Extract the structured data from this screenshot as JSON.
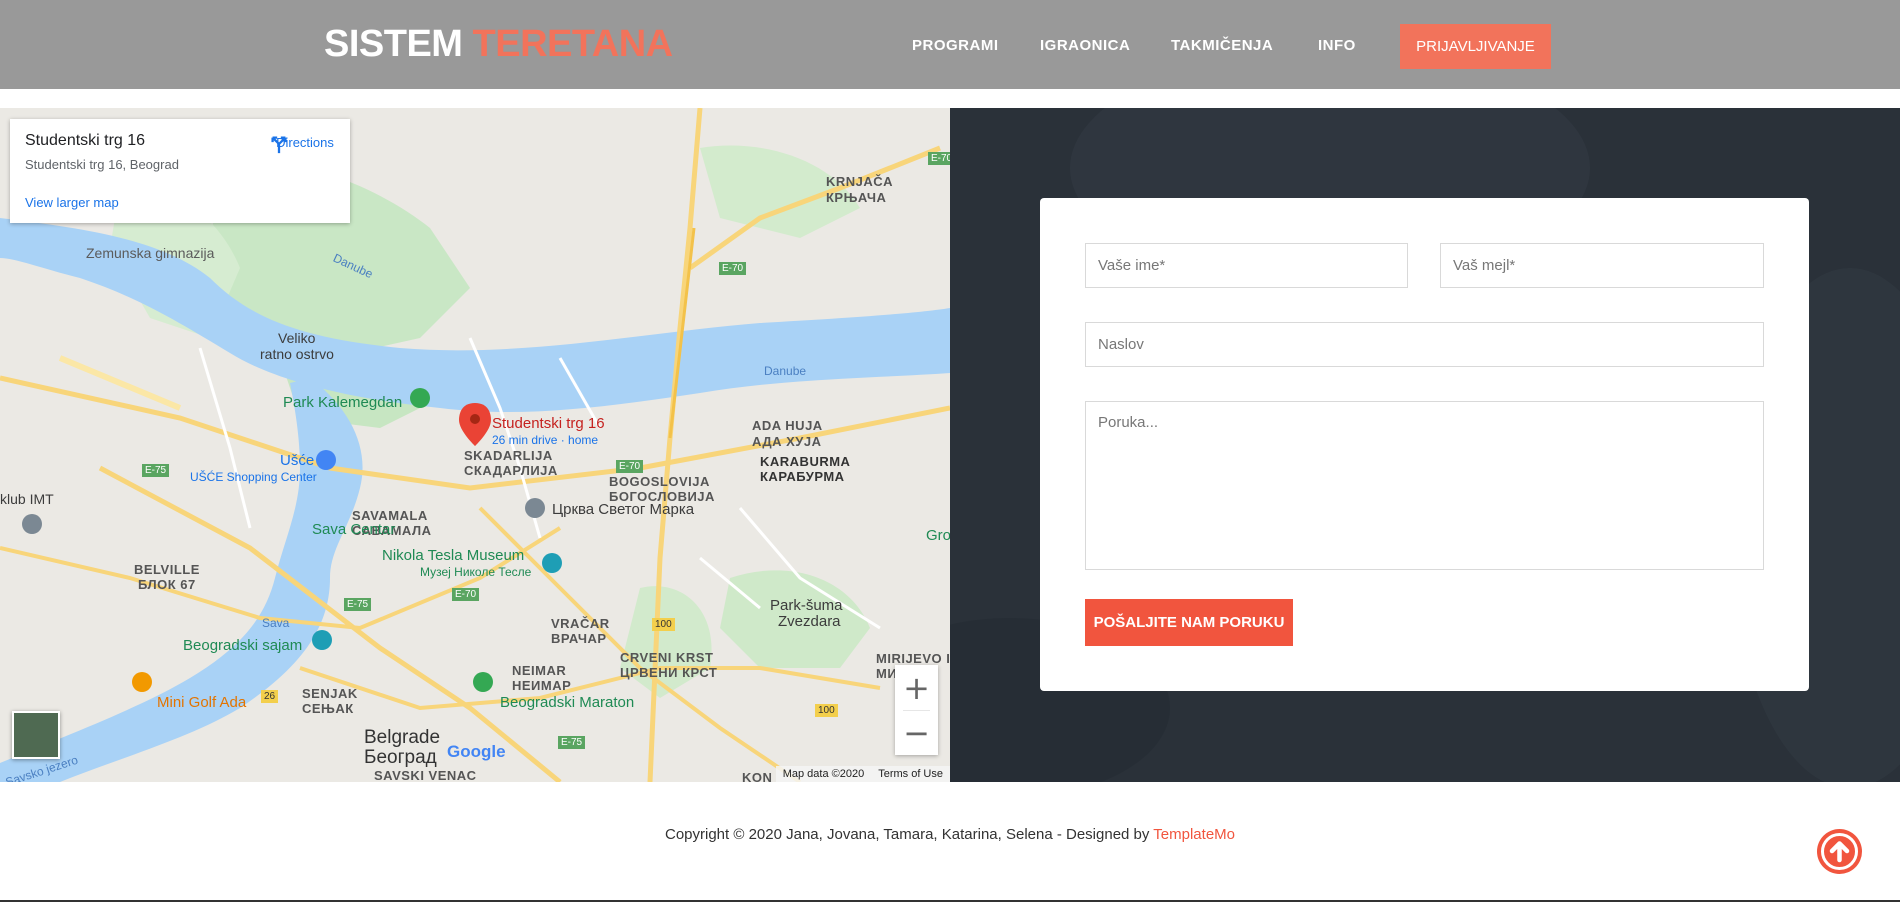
{
  "header": {
    "logo_part1": "SISTEM",
    "logo_part2": "TERETANA",
    "nav": [
      {
        "label": "PROGRAMI"
      },
      {
        "label": "IGRAONICA"
      },
      {
        "label": "TAKMIČENJA"
      },
      {
        "label": "INFO"
      }
    ],
    "cta_label": "PRIJAVLJIVANJE"
  },
  "map": {
    "card": {
      "title": "Studentski trg 16",
      "address": "Studentski trg 16, Beograd",
      "directions_label": "Directions",
      "larger_map_label": "View larger map"
    },
    "pin_title": "Studentski trg 16",
    "pin_subtitle": "26 min drive · home",
    "labels": {
      "zemunska": "Zemunska gimnazija",
      "danube1": "Danube",
      "danube2": "Danube",
      "veliko1": "Veliko",
      "veliko2": "ratno ostrvo",
      "kalemegdan": "Park Kalemegdan",
      "krnjaca1": "KRNJAČA",
      "krnjaca2": "КРЊАЧА",
      "usce": "Ušće",
      "usce_mall": "UŠĆE Shopping Center",
      "klub": "klub IMT",
      "skadarlija1": "SKADARLIJA",
      "skadarlija2": "СКАДАРЛИЈА",
      "ada1": "ADA HUJA",
      "ada2": "АДА ХУЈА",
      "karaburma1": "KARABURMA",
      "karaburma2": "КАРАБУРМА",
      "bogoslovija1": "BOGOSLOVIJA",
      "bogoslovija2": "БОГОСЛОВИЈА",
      "savamala1": "SAVAMALA",
      "savamala2": "САВАМАЛА",
      "crkva": "Црква Светог Марка",
      "sava_centar": "Sava Centar",
      "tesla1": "Nikola Tesla Museum",
      "tesla2": "Музеј Николе Тесле",
      "belville1": "BELVILLE",
      "belville2": "БЛОК 67",
      "vracar1": "VRAČAR",
      "vracar2": "ВРАЧАР",
      "zvezdara1": "Park-šuma",
      "zvezdara2": "Zvezdara",
      "sava_river": "Sava",
      "sajam": "Beogradski sajam",
      "neimar1": "NEIMAR",
      "neimar2": "НЕИМАР",
      "crveni1": "CRVENI KRST",
      "crveni2": "ЦРВЕНИ КРСТ",
      "mirijevo1": "MIRIJEVO I",
      "mirijevo2": "МИРИЈЕ",
      "senjak1": "SENJAK",
      "senjak2": "СЕЊАК",
      "minigolf": "Mini Golf Ada",
      "maraton": "Beogradski Maraton",
      "belgrade1": "Belgrade",
      "belgrade2": "Београд",
      "savski": "SAVSKI VENAC",
      "kon": "KON",
      "gro": "Gro",
      "jezero": "Savsko jezero"
    },
    "highway_e70": "E-70",
    "highway_e75": "E-75",
    "road_100": "100",
    "road_26": "26",
    "google": "Google",
    "footer_data": "Map data ©2020",
    "footer_terms": "Terms of Use"
  },
  "form": {
    "name_placeholder": "Vaše ime*",
    "email_placeholder": "Vaš mejl*",
    "subject_placeholder": "Naslov",
    "message_placeholder": "Poruka...",
    "submit_label": "POŠALJITE NAM PORUKU"
  },
  "footer": {
    "copyright": "Copyright © 2020 Jana, Jovana, Tamara, Katarina, Selena - Designed by ",
    "designer": "TemplateMo"
  },
  "colors": {
    "accent": "#f2735b",
    "button": "#f1553e",
    "header": "#999999",
    "contact_bg": "#2a3139"
  }
}
